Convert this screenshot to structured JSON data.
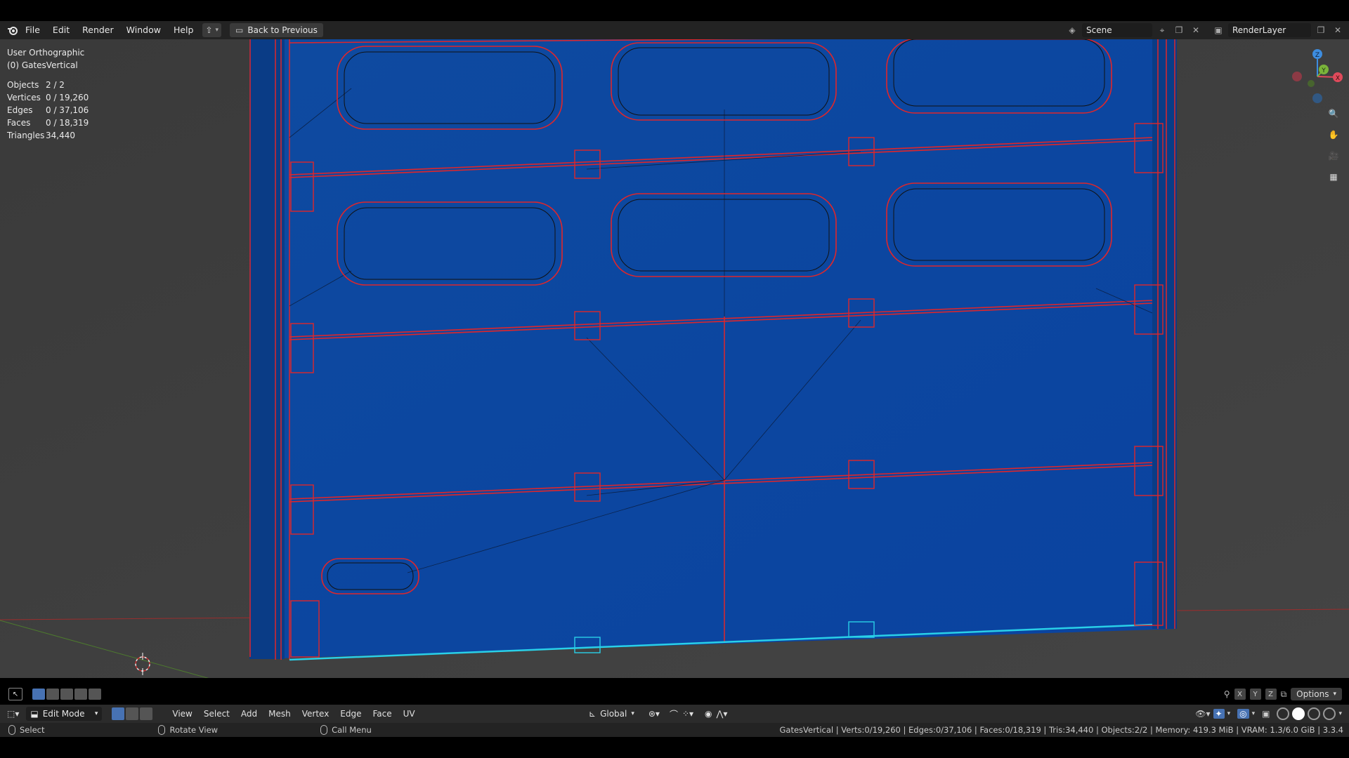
{
  "topbar": {
    "menus": [
      "File",
      "Edit",
      "Render",
      "Window",
      "Help"
    ],
    "back_button": "Back to Previous",
    "scene_field": "Scene",
    "renderlayer_field": "RenderLayer"
  },
  "viewport": {
    "view_name": "User Orthographic",
    "object_name": "(0) GatesVertical",
    "stats": [
      {
        "label": "Objects",
        "value": "2 / 2"
      },
      {
        "label": "Vertices",
        "value": "0 / 19,260"
      },
      {
        "label": "Edges",
        "value": "0 / 37,106"
      },
      {
        "label": "Faces",
        "value": "0 / 18,319"
      },
      {
        "label": "Triangles",
        "value": "34,440"
      }
    ],
    "gizmo_axes": {
      "x": "X",
      "y": "Y",
      "z": "Z"
    },
    "options_label": "Options",
    "axis_buttons": [
      "X",
      "Y",
      "Z"
    ]
  },
  "header3d": {
    "mode": "Edit Mode",
    "menus": [
      "View",
      "Select",
      "Add",
      "Mesh",
      "Vertex",
      "Edge",
      "Face",
      "UV"
    ],
    "orientation": "Global"
  },
  "statusbar": {
    "left_actions": [
      {
        "label": "Select"
      },
      {
        "label": "Rotate View"
      },
      {
        "label": "Call Menu"
      }
    ],
    "right_info": "GatesVertical | Verts:0/19,260 | Edges:0/37,106 | Faces:0/18,319 | Tris:34,440 | Objects:2/2 | Memory: 419.3 MiB | VRAM: 1.3/6.0 GiB | 3.3.4"
  },
  "colors": {
    "accent": "#4772b3",
    "mesh_face": "#0a4fa8",
    "seam": "#e0262a",
    "selected_edge": "#29d0e8",
    "background": "#3d3d3d"
  }
}
